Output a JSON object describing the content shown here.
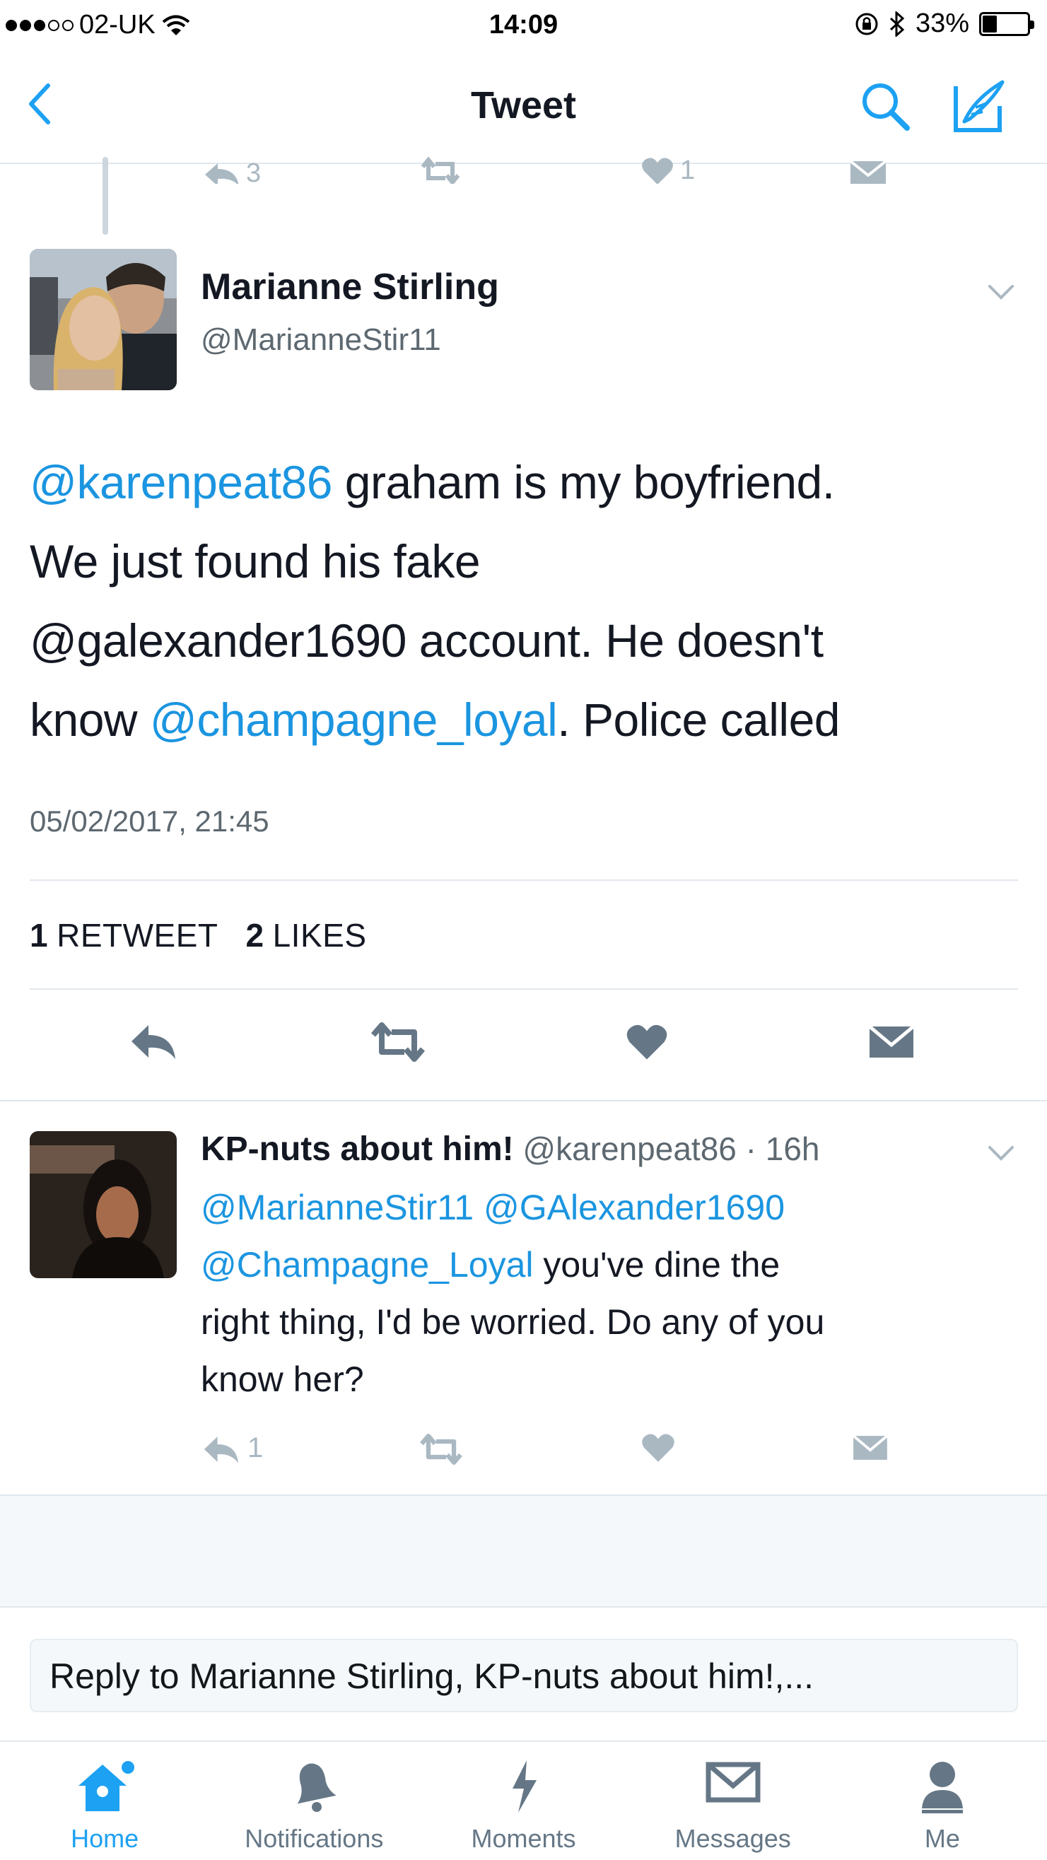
{
  "status_bar": {
    "carrier": "02-UK",
    "time": "14:09",
    "battery": "33%",
    "battery_level": 0.33
  },
  "nav": {
    "title": "Tweet",
    "back_icon": "chevron-left-icon",
    "search_icon": "search-icon",
    "compose_icon": "compose-icon"
  },
  "previous_tweet_actions": {
    "reply_count": "3",
    "like_count": "1"
  },
  "tweet": {
    "name": "Marianne Stirling",
    "handle": "@MarianneStir11",
    "lines": [
      [
        {
          "text": "@karenpeat86",
          "link": true
        },
        {
          "text": " graham is my boyfriend.",
          "link": false
        }
      ],
      [
        {
          "text": "We just found his fake",
          "link": false
        }
      ],
      [
        {
          "text": "@galexander1690 account. He doesn't",
          "link": false
        }
      ],
      [
        {
          "text": "know ",
          "link": false
        },
        {
          "text": "@champagne_loyal",
          "link": true
        },
        {
          "text": ". Police called",
          "link": false
        }
      ]
    ],
    "timestamp": "05/02/2017, 21:45",
    "retweet_count": "1",
    "retweet_label": "RETWEET",
    "like_count": "2",
    "like_label": "LIKES"
  },
  "reply": {
    "name": "KP-nuts about him!",
    "handle": "@karenpeat86",
    "time": "· 16h",
    "lines": [
      [
        {
          "text": "@MarianneStir11 @GAlexander1690",
          "link": true
        }
      ],
      [
        {
          "text": "@Champagne_Loyal",
          "link": true
        },
        {
          "text": " you've dine the",
          "link": false
        }
      ],
      [
        {
          "text": "right thing, I'd be worried. Do any of you",
          "link": false
        }
      ],
      [
        {
          "text": "know her?",
          "link": false
        }
      ]
    ],
    "reply_count": "1"
  },
  "composer": {
    "placeholder": "Reply to Marianne Stirling, KP-nuts about him!,..."
  },
  "tabs": [
    {
      "label": "Home",
      "icon": "home-icon",
      "active": true
    },
    {
      "label": "Notifications",
      "icon": "bell-icon",
      "active": false
    },
    {
      "label": "Moments",
      "icon": "lightning-icon",
      "active": false
    },
    {
      "label": "Messages",
      "icon": "envelope-icon",
      "active": false
    },
    {
      "label": "Me",
      "icon": "person-icon",
      "active": false
    }
  ],
  "colors": {
    "link": "#1b95e0",
    "accent": "#1da1f2",
    "icon_grey": "#657786",
    "divider": "#e1e8ed"
  }
}
